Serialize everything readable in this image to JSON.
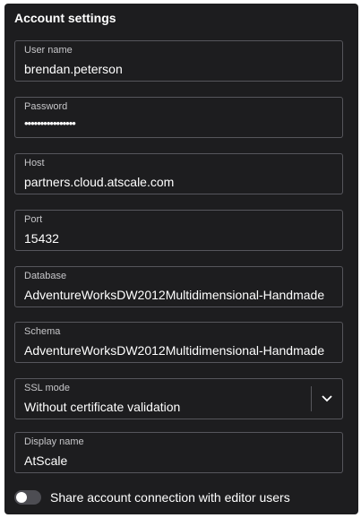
{
  "panel": {
    "title": "Account settings"
  },
  "fields": {
    "username": {
      "label": "User name",
      "value": "brendan.peterson"
    },
    "password": {
      "label": "Password",
      "value": "••••••••••••••••"
    },
    "host": {
      "label": "Host",
      "value": "partners.cloud.atscale.com"
    },
    "port": {
      "label": "Port",
      "value": "15432"
    },
    "database": {
      "label": "Database",
      "value": "AdventureWorksDW2012Multidimensional-Handmade"
    },
    "schema": {
      "label": "Schema",
      "value": "AdventureWorksDW2012Multidimensional-Handmade"
    },
    "ssl_mode": {
      "label": "SSL mode",
      "value": "Without certificate validation"
    },
    "display_name": {
      "label": "Display name",
      "value": "AtScale"
    }
  },
  "share_toggle": {
    "label": "Share account connection with editor users",
    "state": "off"
  },
  "icons": {
    "ssl_dropdown": "chevron-down-icon"
  },
  "colors": {
    "panel_bg": "#1d1d1f",
    "border": "#56565c",
    "text": "#ffffff",
    "label": "#c6c6c9"
  }
}
